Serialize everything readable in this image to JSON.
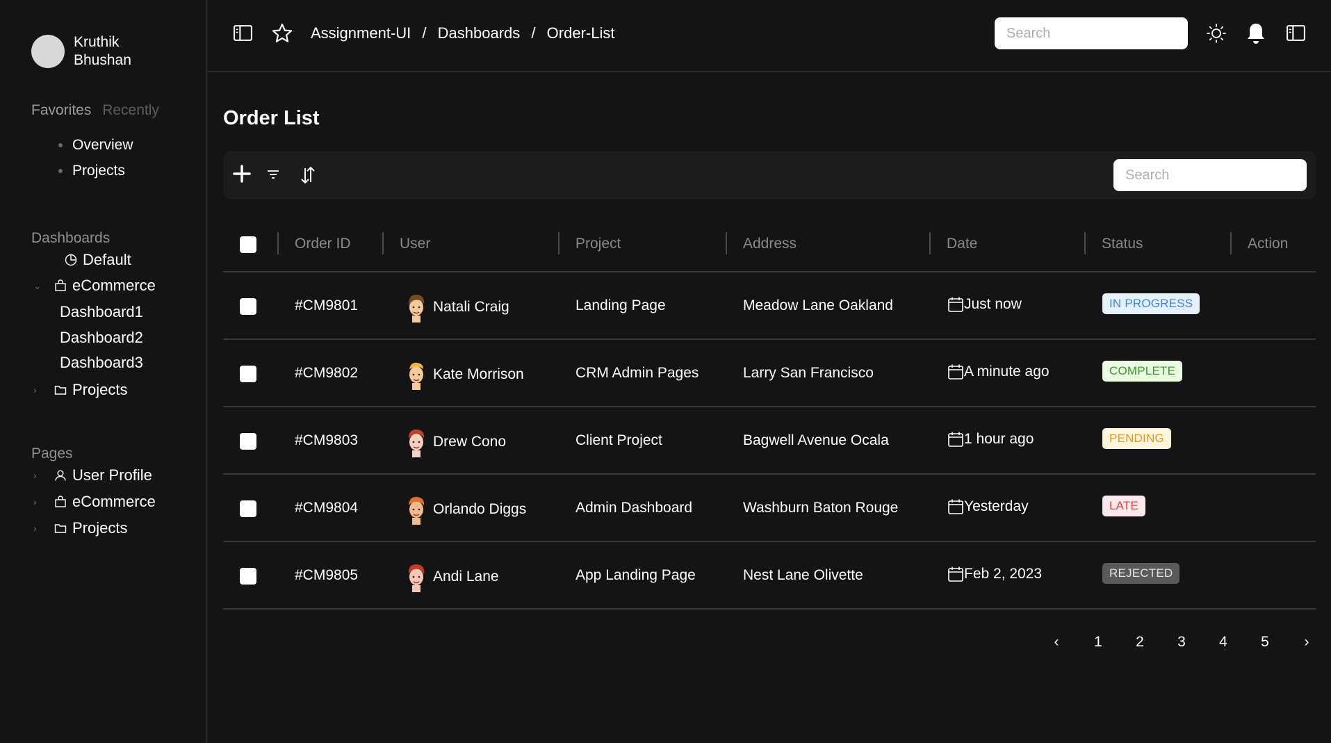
{
  "profile": {
    "name": "Kruthik Bhushan"
  },
  "sidebar": {
    "tabs": [
      "Favorites",
      "Recently"
    ],
    "favorites": [
      "Overview",
      "Projects"
    ],
    "dashboards_title": "Dashboards",
    "dashboards": [
      {
        "label": "Default",
        "icon": "pie-chart-icon"
      },
      {
        "label": "eCommerce",
        "icon": "shopping-bag-icon"
      },
      {
        "label": "Dashboard1"
      },
      {
        "label": "Dashboard2"
      },
      {
        "label": "Dashboard3"
      },
      {
        "label": "Projects",
        "icon": "folder-icon"
      }
    ],
    "pages_title": "Pages",
    "pages": [
      {
        "label": "User Profile",
        "icon": "user-icon"
      },
      {
        "label": "eCommerce",
        "icon": "shopping-bag-icon"
      },
      {
        "label": "Projects",
        "icon": "folder-icon"
      }
    ]
  },
  "topbar": {
    "breadcrumb": [
      "Assignment-UI",
      "Dashboards",
      "Order-List"
    ],
    "separator": "/",
    "search_placeholder": "Search"
  },
  "main": {
    "title": "Order List",
    "search_placeholder": "Search",
    "columns": [
      "Order ID",
      "User",
      "Project",
      "Address",
      "Date",
      "Status",
      "Action"
    ],
    "rows": [
      {
        "id": "#CM9801",
        "user": "Natali Craig",
        "project": "Landing Page",
        "address": "Meadow Lane Oakland",
        "date": "Just now",
        "status": "IN PROGRESS",
        "status_kind": "progress"
      },
      {
        "id": "#CM9802",
        "user": "Kate Morrison",
        "project": "CRM Admin Pages",
        "address": "Larry San Francisco",
        "date": "A minute ago",
        "status": "COMPLETE",
        "status_kind": "complete"
      },
      {
        "id": "#CM9803",
        "user": "Drew Cono",
        "project": "Client Project",
        "address": "Bagwell Avenue Ocala",
        "date": "1 hour ago",
        "status": "PENDING",
        "status_kind": "pending"
      },
      {
        "id": "#CM9804",
        "user": "Orlando Diggs",
        "project": "Admin Dashboard",
        "address": "Washburn Baton Rouge",
        "date": "Yesterday",
        "status": "LATE",
        "status_kind": "late"
      },
      {
        "id": "#CM9805",
        "user": "Andi Lane",
        "project": "App Landing Page",
        "address": "Nest Lane Olivette",
        "date": "Feb 2, 2023",
        "status": "REJECTED",
        "status_kind": "rejected"
      }
    ],
    "pagination": {
      "prev": "‹",
      "pages": [
        "1",
        "2",
        "3",
        "4",
        "5"
      ],
      "next": "›"
    }
  },
  "colors": {
    "background": "#141414",
    "progress_bg": "#e6f1ff",
    "progress_fg": "#3b82f6",
    "complete_bg": "#eafbe4",
    "complete_fg": "#3e9b2e",
    "pending_bg": "#fff5df",
    "pending_fg": "#e39a1e",
    "late_bg": "#fde9e9",
    "late_fg": "#e0443c",
    "rejected_bg": "#5a5a5a",
    "rejected_fg": "#e5e5e5"
  }
}
